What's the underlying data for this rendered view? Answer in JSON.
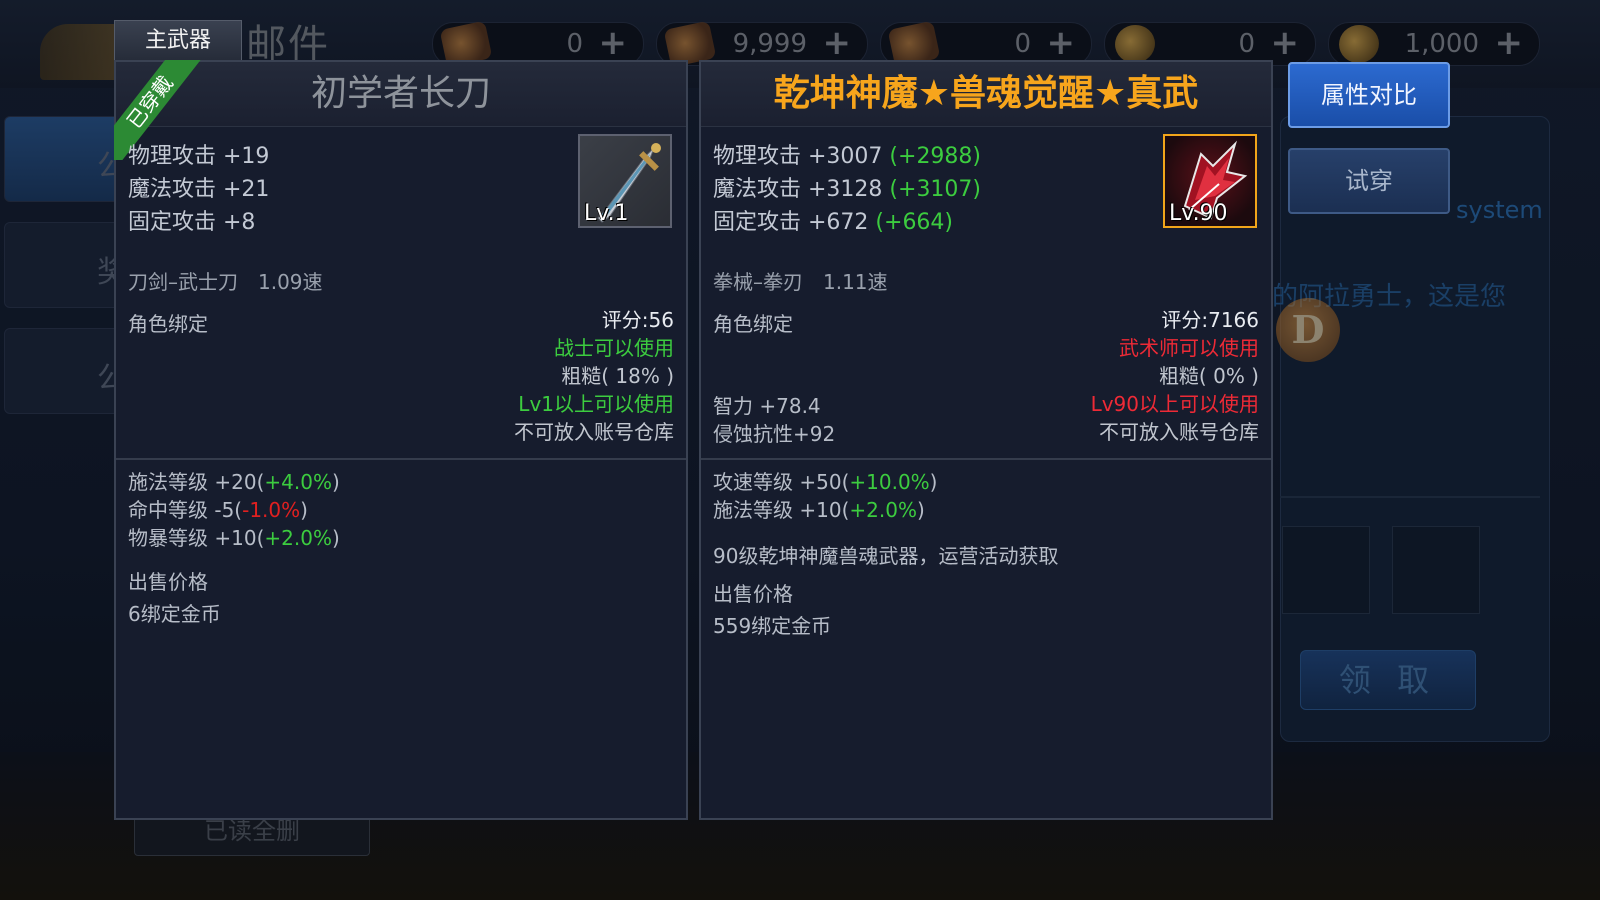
{
  "background": {
    "mail_title": "邮件",
    "currencies": [
      {
        "value": "0",
        "plus": "+",
        "icon": "scroll-icon"
      },
      {
        "value": "9,999",
        "plus": "+",
        "icon": "scroll-icon"
      },
      {
        "value": "0",
        "plus": "+",
        "icon": "scroll-icon"
      },
      {
        "value": "0",
        "plus": "+",
        "icon": "coin-icon"
      },
      {
        "value": "1,000",
        "plus": "+",
        "icon": "coin-icon"
      }
    ],
    "nav": [
      "公",
      "奖",
      "公"
    ],
    "system_label": "system",
    "message": "的阿拉勇士，这是您",
    "avatar_letter": "D",
    "receive_button": "领 取",
    "old_button": "已读全删"
  },
  "tab_label": "主武器",
  "equipped": {
    "ribbon": "已穿戴",
    "name": "初学者长刀",
    "attrs": [
      {
        "label": "物理攻击 +19"
      },
      {
        "label": "魔法攻击 +21"
      },
      {
        "label": "固定攻击 +8"
      }
    ],
    "icon_level": "Lv.1",
    "weapon_type": "刀剑–武士刀　1.09速",
    "bind": "角色绑定",
    "score": "评分:56",
    "class_req": "战士可以使用",
    "rough": "粗糙( 18% )",
    "level_req": "Lv1以上可以使用",
    "storage": "不可放入账号仓库",
    "subs": [
      {
        "text": "施法等级 +20(",
        "val": "+4.0%",
        "end": ")",
        "neg": false
      },
      {
        "text": "命中等级 -5(",
        "val": "-1.0%",
        "end": ")",
        "neg": true
      },
      {
        "text": "物暴等级 +10(",
        "val": "+2.0%",
        "end": ")",
        "neg": false
      }
    ],
    "sell_label": "出售价格",
    "sell_value": "6绑定金币"
  },
  "compare": {
    "name": "乾坤神魔★兽魂觉醒★真武",
    "attrs": [
      {
        "label": "物理攻击 +3007",
        "bonus": "(+2988)"
      },
      {
        "label": "魔法攻击 +3128",
        "bonus": "(+3107)"
      },
      {
        "label": "固定攻击 +672",
        "bonus": "(+664)"
      }
    ],
    "icon_level": "Lv.90",
    "weapon_type": "拳械–拳刃　1.11速",
    "bind": "角色绑定",
    "score": "评分:7166",
    "class_req": "武术师可以使用",
    "rough": "粗糙( 0% )",
    "int_stat": "智力 +78.4",
    "res_stat": "侵蚀抗性+92",
    "level_req": "Lv90以上可以使用",
    "storage": "不可放入账号仓库",
    "subs": [
      {
        "text": "攻速等级 +50(",
        "val": "+10.0%",
        "end": ")"
      },
      {
        "text": "施法等级 +10(",
        "val": "+2.0%",
        "end": ")"
      }
    ],
    "description": "90级乾坤神魔兽魂武器，运营活动获取",
    "sell_label": "出售价格",
    "sell_value": "559绑定金币"
  },
  "buttons": {
    "compare": "属性对比",
    "try_on": "试穿"
  },
  "colors": {
    "bonus_green": "#3ccc3f",
    "negative_red": "#e02020",
    "title_gold": "#f7a51c",
    "ribbon_green": "#2c8a34"
  }
}
